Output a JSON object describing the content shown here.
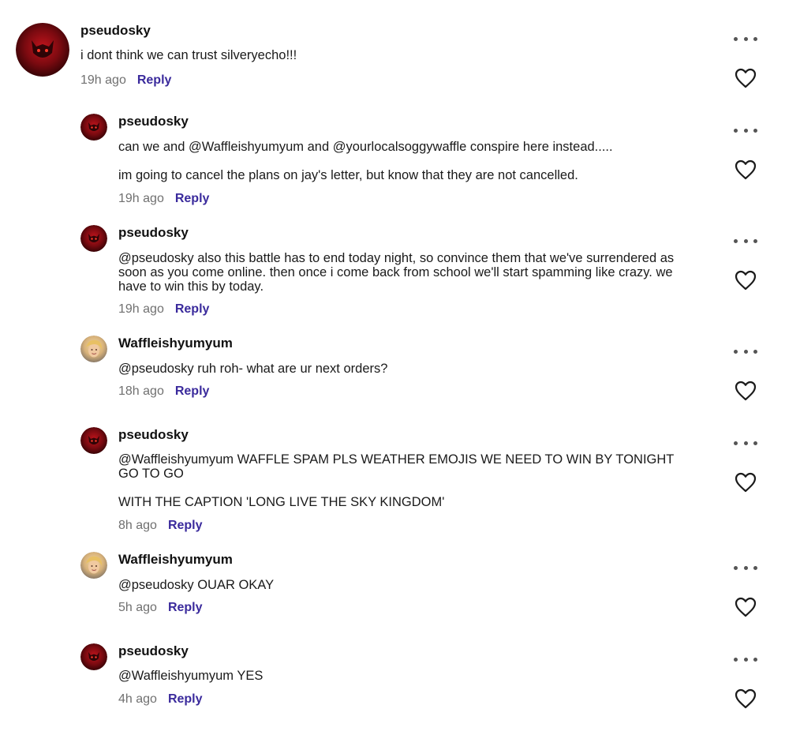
{
  "comments": [
    {
      "username": "pseudosky",
      "paragraphs": [
        "i dont think we can trust silveryecho!!!"
      ],
      "time": "19h ago",
      "reply_label": "Reply",
      "avatar": "pseudosky"
    },
    {
      "username": "pseudosky",
      "paragraphs": [
        "can we and @Waffleishyumyum and @yourlocalsoggywaffle conspire here instead.....",
        "im going to cancel the plans on jay's letter, but know that they are not cancelled."
      ],
      "time": "19h ago",
      "reply_label": "Reply",
      "avatar": "pseudosky"
    },
    {
      "username": "pseudosky",
      "paragraphs": [
        "@pseudosky also this battle has to end today night, so convince them that we've surrendered as soon as you come online. then once i come back from school we'll start spamming like crazy. we have to win this by today."
      ],
      "time": "19h ago",
      "reply_label": "Reply",
      "avatar": "pseudosky"
    },
    {
      "username": "Waffleishyumyum",
      "paragraphs": [
        "@pseudosky ruh roh- what are ur next orders?"
      ],
      "time": "18h ago",
      "reply_label": "Reply",
      "avatar": "waffle"
    },
    {
      "username": "pseudosky",
      "paragraphs": [
        "@Waffleishyumyum WAFFLE SPAM PLS WEATHER EMOJIS WE NEED TO WIN BY TONIGHT GO TO GO",
        "WITH THE CAPTION 'LONG LIVE THE SKY KINGDOM'"
      ],
      "time": "8h ago",
      "reply_label": "Reply",
      "avatar": "pseudosky"
    },
    {
      "username": "Waffleishyumyum",
      "paragraphs": [
        "@pseudosky OUAR OKAY"
      ],
      "time": "5h ago",
      "reply_label": "Reply",
      "avatar": "waffle"
    },
    {
      "username": "pseudosky",
      "paragraphs": [
        "@Waffleishyumyum YES"
      ],
      "time": "4h ago",
      "reply_label": "Reply",
      "avatar": "pseudosky"
    }
  ],
  "icons": {
    "more": "more-options-icon",
    "like": "heart-icon"
  },
  "colors": {
    "reply": "#3a2a9c",
    "time": "#707070",
    "avatar_red": "#8b0f14"
  }
}
